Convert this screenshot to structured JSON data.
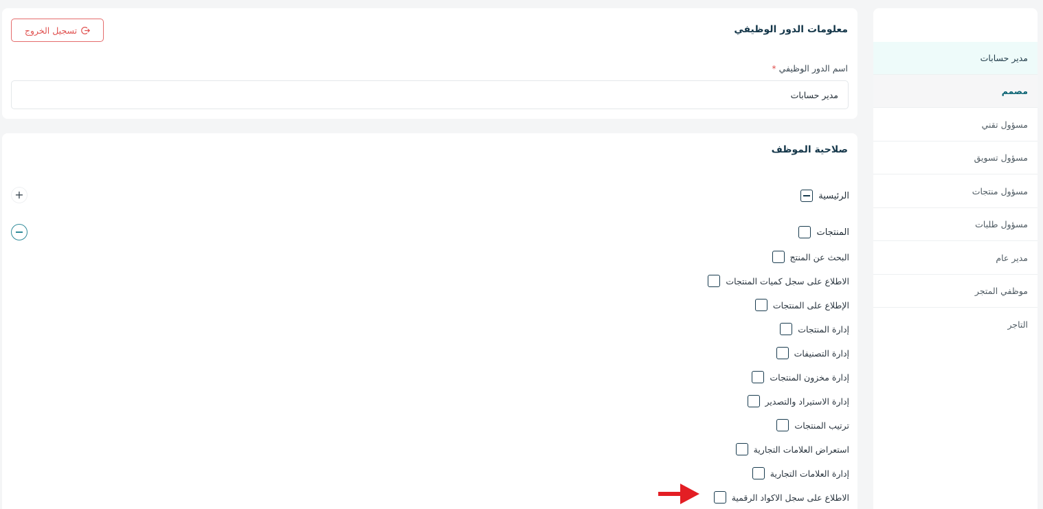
{
  "sidebar": {
    "items": [
      {
        "label": "مدير حسابات",
        "state": "active"
      },
      {
        "label": "مصمم",
        "state": "hovered"
      },
      {
        "label": "مسؤول تقني",
        "state": "normal"
      },
      {
        "label": "مسؤول تسويق",
        "state": "normal"
      },
      {
        "label": "مسؤول منتجات",
        "state": "normal"
      },
      {
        "label": "مسؤول طلبات",
        "state": "normal"
      },
      {
        "label": "مدير عام",
        "state": "normal"
      },
      {
        "label": "موظفي المتجر",
        "state": "normal"
      },
      {
        "label": "التاجر",
        "state": "normal"
      }
    ]
  },
  "role_info": {
    "title": "معلومات الدور الوظيفي",
    "logout_label": "تسجيل الخروج",
    "field_label": "اسم الدور الوظيفي",
    "required_mark": "*",
    "field_value": "مدير حسابات"
  },
  "permissions": {
    "title": "صلاحية الموظف",
    "groups": [
      {
        "label": "الرئيسية",
        "checkbox_state": "indeterminate",
        "expanded": false,
        "toggle_icon": "plus-icon"
      },
      {
        "label": "المنتجات",
        "checkbox_state": "unchecked",
        "expanded": true,
        "toggle_icon": "minus-circle-icon"
      }
    ],
    "product_items": [
      "البحث عن المنتج",
      "الاطلاع على سجل كميات المنتجات",
      "الإطلاع على المنتجات",
      "إدارة المنتجات",
      "إدارة التصنيفات",
      "إدارة مخزون المنتجات",
      "إدارة الاستيراد والتصدير",
      "ترتيب المنتجات",
      "استعراض العلامات التجارية",
      "إدارة العلامات التجارية",
      "الاطلاع على سجل الاكواد الرقمية"
    ]
  },
  "annotation": {
    "icon": "red-arrow-icon",
    "color": "#e31e24"
  },
  "colors": {
    "primary": "#173a4d",
    "accent": "#2f8a99",
    "danger": "#e0514f",
    "active_bg": "#eefbfa"
  }
}
